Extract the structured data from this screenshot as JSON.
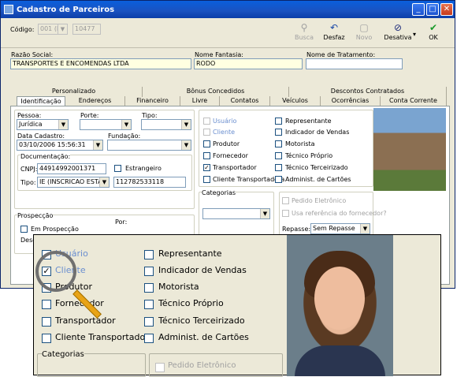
{
  "window": {
    "title": "Cadastro de Parceiros",
    "minimize": "_",
    "maximize": "□",
    "close": "✕"
  },
  "toolbar": {
    "codigo_label": "Código:",
    "codigo_prefix": "001 (M",
    "codigo_value": "10477",
    "buttons": [
      {
        "label": "Busca",
        "icon": "search-icon",
        "enabled": false
      },
      {
        "label": "Desfaz",
        "icon": "undo-icon",
        "enabled": true
      },
      {
        "label": "Novo",
        "icon": "new-document-icon",
        "enabled": false
      },
      {
        "label": "Desativa",
        "icon": "deactivate-icon",
        "enabled": true
      },
      {
        "label": "OK",
        "icon": "check-icon",
        "enabled": true
      }
    ]
  },
  "header_fields": {
    "razao_social_label": "Razão Social:",
    "razao_social_value": "TRANSPORTES E ENCOMENDAS LTDA",
    "nome_fantasia_label": "Nome Fantasia:",
    "nome_fantasia_value": "RODO",
    "nome_tratamento_label": "Nome de Tratamento:",
    "nome_tratamento_value": ""
  },
  "tabs_top": [
    "Personalizado",
    "Bônus Concedidos",
    "Descontos Contratados"
  ],
  "tabs_bottom": [
    "Identificação",
    "Endereços",
    "Financeiro",
    "Livre",
    "Contatos",
    "Veículos",
    "Ocorrências",
    "Conta Corrente"
  ],
  "ident": {
    "pessoa_label": "Pessoa:",
    "pessoa_value": "Jurídica",
    "porte_label": "Porte:",
    "porte_value": "",
    "tipo_label": "Tipo:",
    "tipo_value": "",
    "data_cadastro_label": "Data Cadastro:",
    "data_cadastro_value": "03/10/2006 15:56:31",
    "fundacao_label": "Fundação:",
    "fundacao_value": "",
    "documentacao_label": "Documentação:",
    "cnpj_label": "CNPJ:",
    "cnpj_value": "44914992001371",
    "estrangeiro_label": "Estrangeiro",
    "tipo_doc_label": "Tipo:",
    "tipo_doc_value": "IE (INSCRICAO ESTA",
    "ie_value": "112782533118",
    "prospeccao_label": "Prospecção",
    "em_prospeccao_label": "Em Prospecção",
    "por_label": "Por:",
    "desde_label": "Desd"
  },
  "roles": {
    "col1": [
      {
        "label": "Usuário",
        "checked": false,
        "style": "blue"
      },
      {
        "label": "Cliente",
        "checked": false,
        "style": "blue"
      },
      {
        "label": "Produtor",
        "checked": false,
        "style": "normal"
      },
      {
        "label": "Fornecedor",
        "checked": false,
        "style": "normal"
      },
      {
        "label": "Transportador",
        "checked": true,
        "style": "normal"
      },
      {
        "label": "Cliente Transportadora",
        "checked": false,
        "style": "normal"
      }
    ],
    "col2": [
      {
        "label": "Representante",
        "checked": false
      },
      {
        "label": "Indicador de Vendas",
        "checked": false
      },
      {
        "label": "Motorista",
        "checked": false
      },
      {
        "label": "Técnico Próprio",
        "checked": false
      },
      {
        "label": "Técnico Terceirizado",
        "checked": false
      },
      {
        "label": "Administ. de Cartões",
        "checked": false
      }
    ],
    "categorias_label": "Categorias",
    "pedido_eletronico_label": "Pedido Eletrônico",
    "usa_referencia_label": "Usa referência do fornecedor?",
    "repasse_label": "Repasse:",
    "repasse_value": "Sem Repasse"
  },
  "zoom": {
    "col1": [
      {
        "label": "Usuário",
        "checked": false,
        "style": "blue"
      },
      {
        "label": "Cliente",
        "checked": true,
        "style": "blue"
      },
      {
        "label": "Produtor",
        "checked": false,
        "style": "normal"
      },
      {
        "label": "Fornecedor",
        "checked": false,
        "style": "normal"
      },
      {
        "label": "Transportador",
        "checked": false,
        "style": "normal"
      },
      {
        "label": "Cliente Transportadora",
        "checked": false,
        "style": "normal"
      }
    ],
    "col2": [
      {
        "label": "Representante",
        "checked": false
      },
      {
        "label": "Indicador de Vendas",
        "checked": false
      },
      {
        "label": "Motorista",
        "checked": false
      },
      {
        "label": "Técnico Próprio",
        "checked": false
      },
      {
        "label": "Técnico Terceirizado",
        "checked": false
      },
      {
        "label": "Administ. de Cartões",
        "checked": false
      }
    ],
    "categorias_label": "Categorias",
    "pedido_eletronico_label": "Pedido Eletrônico"
  }
}
